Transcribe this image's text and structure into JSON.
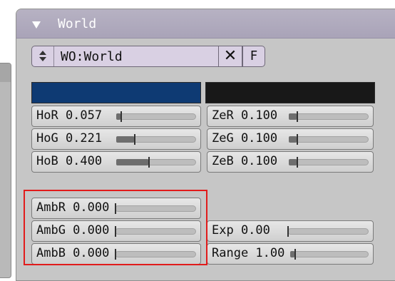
{
  "panel": {
    "title": "World",
    "datablock_name": "WO:World",
    "unlink_label": "✕",
    "fake_user_label": "F"
  },
  "colors": {
    "horizon_swatch": "#0e3a73",
    "zenith_swatch": "#181818",
    "highlight": "#e11b1b"
  },
  "horizon_fields": [
    {
      "label": "HoR 0.057",
      "value": 0.057
    },
    {
      "label": "HoG 0.221",
      "value": 0.221
    },
    {
      "label": "HoB 0.400",
      "value": 0.4
    }
  ],
  "zenith_fields": [
    {
      "label": "ZeR 0.100",
      "value": 0.1
    },
    {
      "label": "ZeG 0.100",
      "value": 0.1
    },
    {
      "label": "ZeB 0.100",
      "value": 0.1
    }
  ],
  "ambient_fields": [
    {
      "label": "AmbR 0.000",
      "value": 0.0
    },
    {
      "label": "AmbG 0.000",
      "value": 0.0
    },
    {
      "label": "AmbB 0.000",
      "value": 0.0
    }
  ],
  "exposure_fields": [
    {
      "label": "Exp 0.00",
      "value": 0.0
    },
    {
      "label": "Range 1.00",
      "value": 1.0
    }
  ]
}
